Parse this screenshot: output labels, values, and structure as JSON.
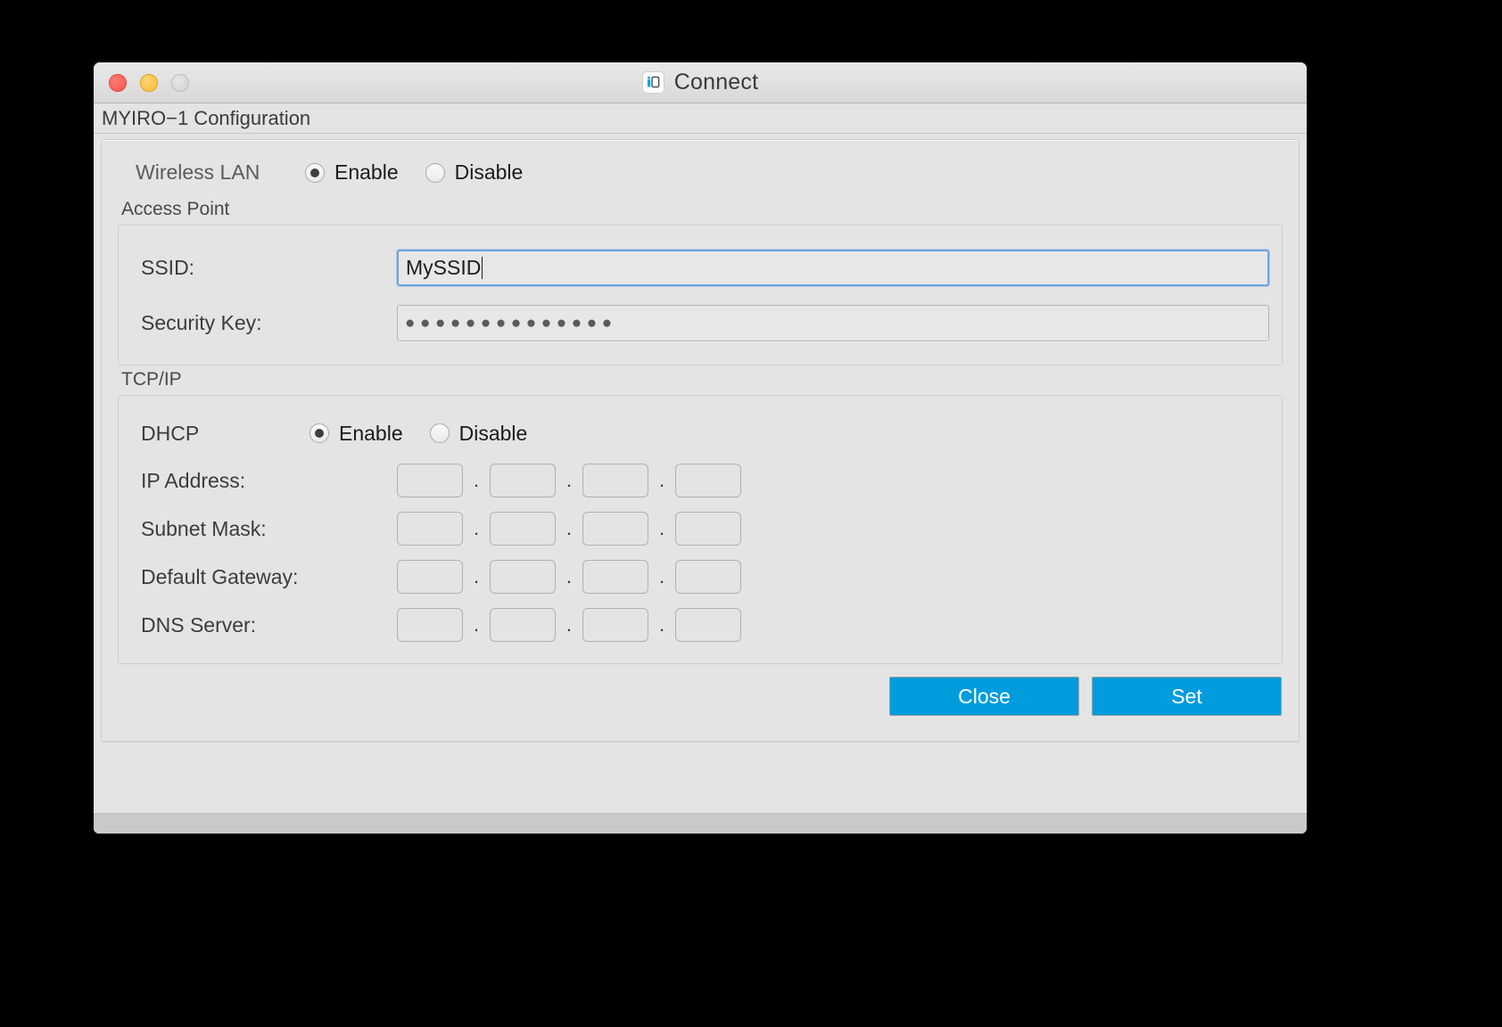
{
  "window": {
    "title": "Connect",
    "app_icon": "myiro-app-icon",
    "traffic_lights": [
      {
        "name": "close",
        "color": "#f9564c"
      },
      {
        "name": "minimize",
        "color": "#fdbd30"
      },
      {
        "name": "zoom",
        "color": "#d2d2d2"
      }
    ]
  },
  "panel": {
    "header": "MYIRO−1 Configuration"
  },
  "wireless_lan": {
    "label": "Wireless LAN",
    "options": [
      {
        "label": "Enable",
        "selected": true
      },
      {
        "label": "Disable",
        "selected": false
      }
    ],
    "enable_label": "Enable",
    "disable_label": "Disable"
  },
  "access_point": {
    "title": "Access Point",
    "ssid": {
      "label": "SSID:",
      "value": "MySSID",
      "focused": true
    },
    "security_key": {
      "label": "Security Key:",
      "value": "●●●●●●●●●●●●●●",
      "masked": true,
      "char_count": 14
    }
  },
  "tcpip": {
    "title": "TCP/IP",
    "dhcp": {
      "label": "DHCP",
      "enable_label": "Enable",
      "disable_label": "Disable",
      "selected": "Enable"
    },
    "separator": ".",
    "rows": [
      {
        "label": "IP Address:",
        "octets": [
          "",
          "",
          "",
          ""
        ],
        "enabled": false
      },
      {
        "label": "Subnet Mask:",
        "octets": [
          "",
          "",
          "",
          ""
        ],
        "enabled": false
      },
      {
        "label": "Default Gateway:",
        "octets": [
          "",
          "",
          "",
          ""
        ],
        "enabled": false
      },
      {
        "label": "DNS Server:",
        "octets": [
          "",
          "",
          "",
          ""
        ],
        "enabled": false
      }
    ]
  },
  "buttons": {
    "close": "Close",
    "set": "Set",
    "accent_color": "#009cdd"
  }
}
